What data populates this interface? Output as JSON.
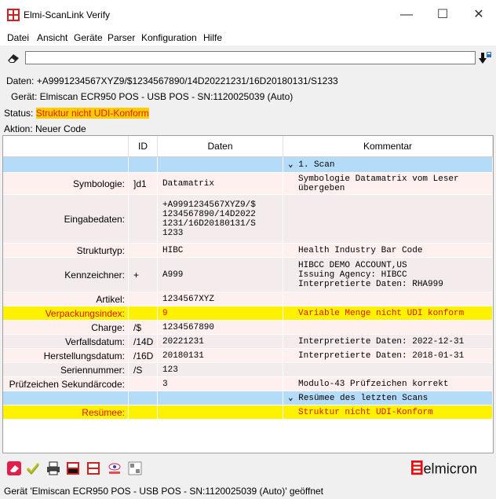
{
  "window": {
    "title": "Elmi-ScanLink Verify",
    "minimize": "—",
    "maximize": "☐",
    "close": "✕"
  },
  "menu": [
    "Datei",
    "Ansicht",
    "Geräte",
    "Parser",
    "Konfiguration",
    "Hilfe"
  ],
  "input": {
    "value": ""
  },
  "info": {
    "daten": "Daten: +A9991234567XYZ9/$1234567890/14D20221231/16D20180131/S1233",
    "geraet": "Gerät: Elmiscan ECR950 POS - USB POS - SN:1120025039 (Auto)",
    "status_label": "Status: ",
    "status_value": "Struktur nicht UDI-Konform",
    "aktion": "Aktion: Neuer Code"
  },
  "table": {
    "headers": [
      "",
      "ID",
      "Daten",
      "Kommentar"
    ],
    "rows": [
      {
        "type": "section",
        "label": "",
        "id": "",
        "data": "",
        "comment": "1. Scan"
      },
      {
        "type": "pink",
        "label": "Symbologie:",
        "id": "]d1",
        "data": "Datamatrix",
        "comment": "Symbologie Datamatrix vom Leser\nübergeben"
      },
      {
        "type": "gray",
        "label": "Eingabedaten:",
        "id": "",
        "data": "+A9991234567XYZ9/$\n1234567890/14D2022\n1231/16D20180131/S\n1233",
        "comment": ""
      },
      {
        "type": "pink",
        "label": "Strukturtyp:",
        "id": "",
        "data": "HIBC",
        "comment": "Health Industry Bar Code"
      },
      {
        "type": "gray",
        "label": "Kennzeichner:",
        "id": "+",
        "data": "A999",
        "comment": "HIBCC DEMO ACCOUNT,US\nIssuing Agency: HIBCC\nInterpretierte Daten: RHA999"
      },
      {
        "type": "pink",
        "label": "Artikel:",
        "id": "",
        "data": "1234567XYZ",
        "comment": ""
      },
      {
        "type": "yellow",
        "label": "Verpackungsindex:",
        "id": "",
        "data": "9",
        "comment": "Variable Menge nicht UDI konform"
      },
      {
        "type": "pink",
        "label": "Charge:",
        "id": "/$",
        "data": "1234567890",
        "comment": ""
      },
      {
        "type": "gray",
        "label": "Verfallsdatum:",
        "id": "/14D",
        "data": "20221231",
        "comment": "Interpretierte Daten: 2022-12-31"
      },
      {
        "type": "pink",
        "label": "Herstellungsdatum:",
        "id": "/16D",
        "data": "20180131",
        "comment": "Interpretierte Daten: 2018-01-31"
      },
      {
        "type": "gray",
        "label": "Seriennummer:",
        "id": "/S",
        "data": "123",
        "comment": ""
      },
      {
        "type": "pink",
        "label": "Prüfzeichen Sekundärcode:",
        "id": "",
        "data": "3",
        "comment": "Modulo-43 Prüfzeichen korrekt"
      },
      {
        "type": "section",
        "label": "",
        "id": "",
        "data": "",
        "comment": "Resümee des letzten Scans"
      },
      {
        "type": "yellow",
        "label": "Resümee:",
        "id": "",
        "data": "",
        "comment": "Struktur nicht UDI-Konform"
      }
    ]
  },
  "bottom_toolbar": [
    "eraser-icon",
    "checkmark-icon",
    "printer-icon",
    "pdf-icon",
    "pdf-export-icon",
    "eye-icon",
    "udi-icon"
  ],
  "logo": "elmicron",
  "statusbar": "Gerät 'Elmiscan ECR950 POS - USB POS - SN:1120025039 (Auto)' geöffnet",
  "colors": {
    "section": "#b4dcf8",
    "pink": "#fff0f0",
    "gray": "#f4ecec",
    "yellow": "#fff200",
    "warn_text": "#e01010",
    "status_bg": "#ffcc00"
  }
}
